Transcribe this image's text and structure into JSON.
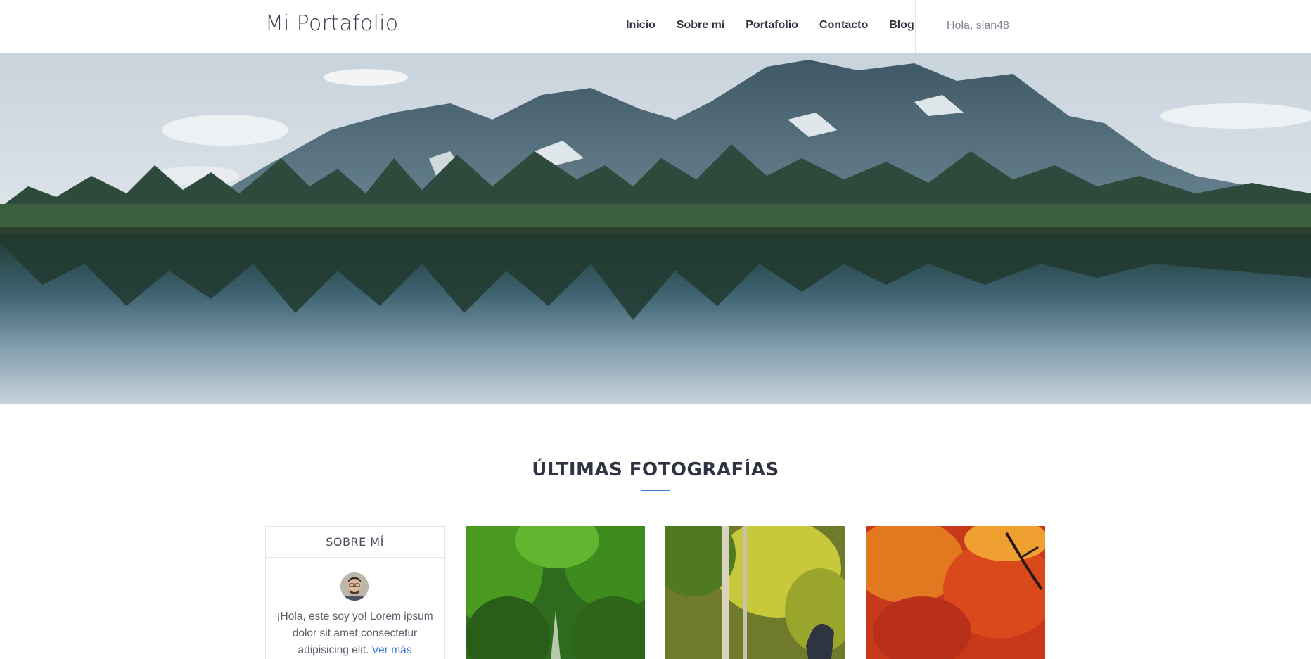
{
  "header": {
    "brand": "Mi Portafolio",
    "nav": [
      "Inicio",
      "Sobre mí",
      "Portafolio",
      "Contacto",
      "Blog"
    ],
    "greeting": "Hola, slan48"
  },
  "hero": {
    "image": "mountain-lake-landscape"
  },
  "section": {
    "title": "ÚLTIMAS FOTOGRAFÍAS"
  },
  "about": {
    "title": "SOBRE MÍ",
    "text": "¡Hola, este soy yo! Lorem ipsum dolor sit amet consectetur adipisicing elit.",
    "link": "Ver más"
  },
  "gallery": [
    {
      "image": "green-forest-path"
    },
    {
      "image": "autumn-forest-sculpture"
    },
    {
      "image": "red-autumn-tree"
    }
  ],
  "colors": {
    "accent": "#3d7bd6",
    "text_dark": "#2f3342",
    "border": "#e3e5ea"
  }
}
